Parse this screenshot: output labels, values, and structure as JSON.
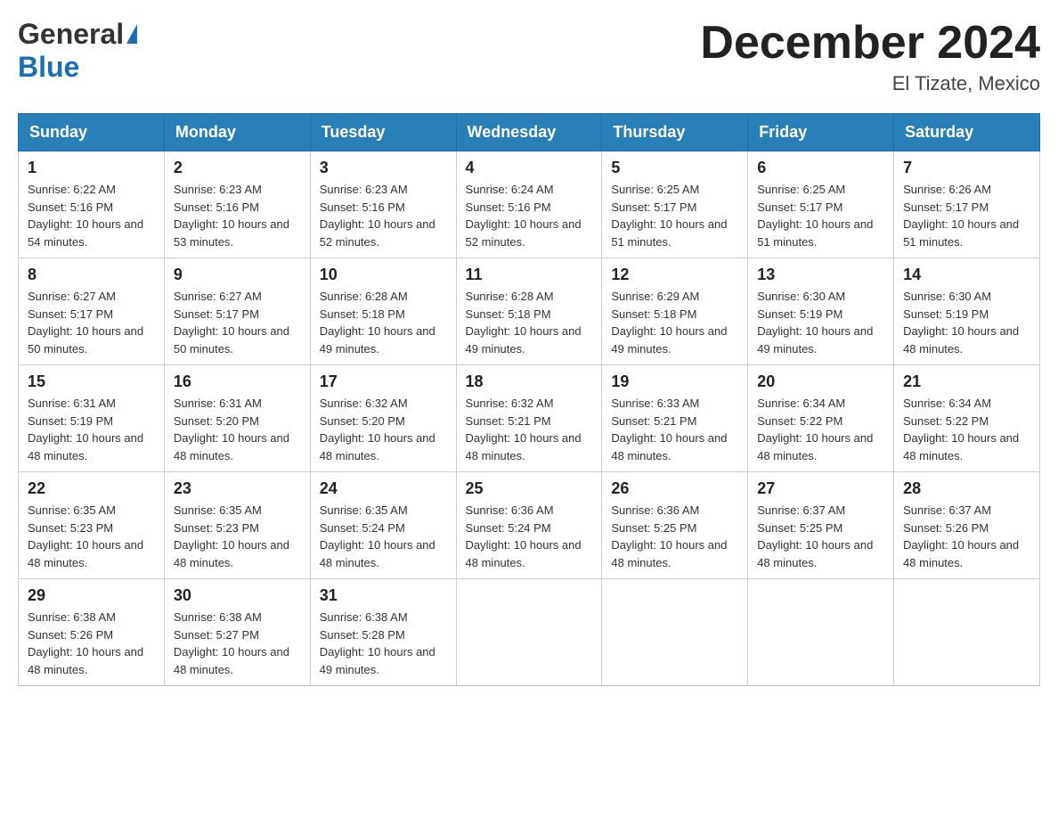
{
  "header": {
    "logo_general": "General",
    "logo_blue": "Blue",
    "month_title": "December 2024",
    "location": "El Tizate, Mexico"
  },
  "days_of_week": [
    "Sunday",
    "Monday",
    "Tuesday",
    "Wednesday",
    "Thursday",
    "Friday",
    "Saturday"
  ],
  "weeks": [
    [
      {
        "day": "1",
        "sunrise": "6:22 AM",
        "sunset": "5:16 PM",
        "daylight": "10 hours and 54 minutes."
      },
      {
        "day": "2",
        "sunrise": "6:23 AM",
        "sunset": "5:16 PM",
        "daylight": "10 hours and 53 minutes."
      },
      {
        "day": "3",
        "sunrise": "6:23 AM",
        "sunset": "5:16 PM",
        "daylight": "10 hours and 52 minutes."
      },
      {
        "day": "4",
        "sunrise": "6:24 AM",
        "sunset": "5:16 PM",
        "daylight": "10 hours and 52 minutes."
      },
      {
        "day": "5",
        "sunrise": "6:25 AM",
        "sunset": "5:17 PM",
        "daylight": "10 hours and 51 minutes."
      },
      {
        "day": "6",
        "sunrise": "6:25 AM",
        "sunset": "5:17 PM",
        "daylight": "10 hours and 51 minutes."
      },
      {
        "day": "7",
        "sunrise": "6:26 AM",
        "sunset": "5:17 PM",
        "daylight": "10 hours and 51 minutes."
      }
    ],
    [
      {
        "day": "8",
        "sunrise": "6:27 AM",
        "sunset": "5:17 PM",
        "daylight": "10 hours and 50 minutes."
      },
      {
        "day": "9",
        "sunrise": "6:27 AM",
        "sunset": "5:17 PM",
        "daylight": "10 hours and 50 minutes."
      },
      {
        "day": "10",
        "sunrise": "6:28 AM",
        "sunset": "5:18 PM",
        "daylight": "10 hours and 49 minutes."
      },
      {
        "day": "11",
        "sunrise": "6:28 AM",
        "sunset": "5:18 PM",
        "daylight": "10 hours and 49 minutes."
      },
      {
        "day": "12",
        "sunrise": "6:29 AM",
        "sunset": "5:18 PM",
        "daylight": "10 hours and 49 minutes."
      },
      {
        "day": "13",
        "sunrise": "6:30 AM",
        "sunset": "5:19 PM",
        "daylight": "10 hours and 49 minutes."
      },
      {
        "day": "14",
        "sunrise": "6:30 AM",
        "sunset": "5:19 PM",
        "daylight": "10 hours and 48 minutes."
      }
    ],
    [
      {
        "day": "15",
        "sunrise": "6:31 AM",
        "sunset": "5:19 PM",
        "daylight": "10 hours and 48 minutes."
      },
      {
        "day": "16",
        "sunrise": "6:31 AM",
        "sunset": "5:20 PM",
        "daylight": "10 hours and 48 minutes."
      },
      {
        "day": "17",
        "sunrise": "6:32 AM",
        "sunset": "5:20 PM",
        "daylight": "10 hours and 48 minutes."
      },
      {
        "day": "18",
        "sunrise": "6:32 AM",
        "sunset": "5:21 PM",
        "daylight": "10 hours and 48 minutes."
      },
      {
        "day": "19",
        "sunrise": "6:33 AM",
        "sunset": "5:21 PM",
        "daylight": "10 hours and 48 minutes."
      },
      {
        "day": "20",
        "sunrise": "6:34 AM",
        "sunset": "5:22 PM",
        "daylight": "10 hours and 48 minutes."
      },
      {
        "day": "21",
        "sunrise": "6:34 AM",
        "sunset": "5:22 PM",
        "daylight": "10 hours and 48 minutes."
      }
    ],
    [
      {
        "day": "22",
        "sunrise": "6:35 AM",
        "sunset": "5:23 PM",
        "daylight": "10 hours and 48 minutes."
      },
      {
        "day": "23",
        "sunrise": "6:35 AM",
        "sunset": "5:23 PM",
        "daylight": "10 hours and 48 minutes."
      },
      {
        "day": "24",
        "sunrise": "6:35 AM",
        "sunset": "5:24 PM",
        "daylight": "10 hours and 48 minutes."
      },
      {
        "day": "25",
        "sunrise": "6:36 AM",
        "sunset": "5:24 PM",
        "daylight": "10 hours and 48 minutes."
      },
      {
        "day": "26",
        "sunrise": "6:36 AM",
        "sunset": "5:25 PM",
        "daylight": "10 hours and 48 minutes."
      },
      {
        "day": "27",
        "sunrise": "6:37 AM",
        "sunset": "5:25 PM",
        "daylight": "10 hours and 48 minutes."
      },
      {
        "day": "28",
        "sunrise": "6:37 AM",
        "sunset": "5:26 PM",
        "daylight": "10 hours and 48 minutes."
      }
    ],
    [
      {
        "day": "29",
        "sunrise": "6:38 AM",
        "sunset": "5:26 PM",
        "daylight": "10 hours and 48 minutes."
      },
      {
        "day": "30",
        "sunrise": "6:38 AM",
        "sunset": "5:27 PM",
        "daylight": "10 hours and 48 minutes."
      },
      {
        "day": "31",
        "sunrise": "6:38 AM",
        "sunset": "5:28 PM",
        "daylight": "10 hours and 49 minutes."
      },
      null,
      null,
      null,
      null
    ]
  ]
}
